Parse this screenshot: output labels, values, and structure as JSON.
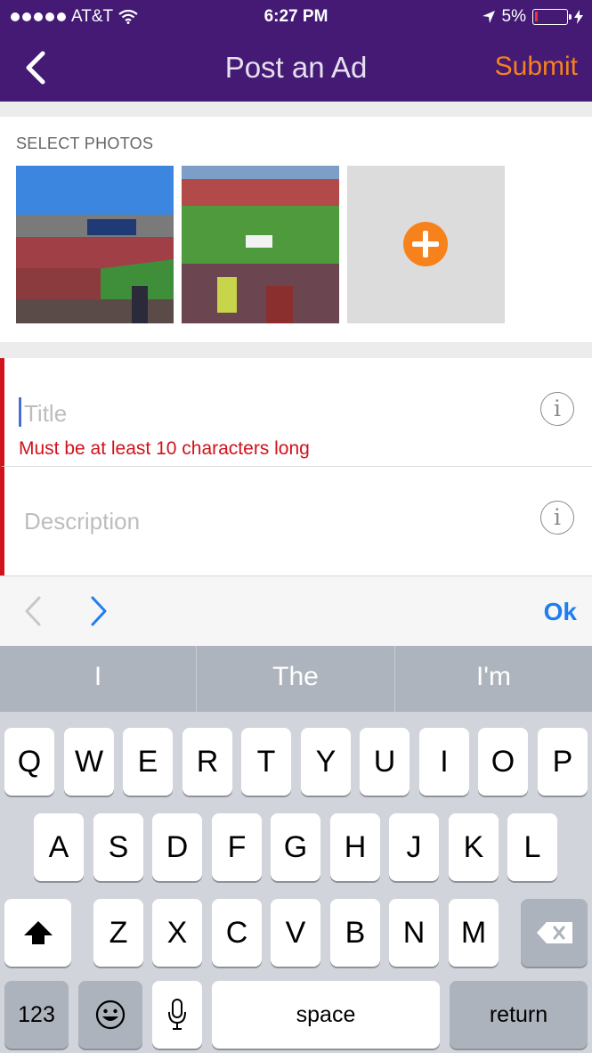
{
  "status_bar": {
    "carrier": "AT&T",
    "time": "6:27 PM",
    "battery": "5%"
  },
  "nav": {
    "title": "Post an Ad",
    "submit": "Submit",
    "back_icon": "chevron-left-icon"
  },
  "photos": {
    "label": "SELECT PHOTOS",
    "add_icon": "plus-circle-icon"
  },
  "form": {
    "title_placeholder": "Title",
    "title_error": "Must be at least 10 characters long",
    "description_placeholder": "Description",
    "info_symbol": "i"
  },
  "accessory": {
    "ok_label": "Ok"
  },
  "keyboard": {
    "suggestions": [
      "I",
      "The",
      "I'm"
    ],
    "row1": [
      "Q",
      "W",
      "E",
      "R",
      "T",
      "Y",
      "U",
      "I",
      "O",
      "P"
    ],
    "row2": [
      "A",
      "S",
      "D",
      "F",
      "G",
      "H",
      "J",
      "K",
      "L"
    ],
    "row3": [
      "Z",
      "X",
      "C",
      "V",
      "B",
      "N",
      "M"
    ],
    "numbers_label": "123",
    "space_label": "space",
    "return_label": "return"
  },
  "colors": {
    "nav_background": "#441a75",
    "accent": "#f7821b",
    "error": "#d0121b",
    "link": "#1e7ef0"
  }
}
